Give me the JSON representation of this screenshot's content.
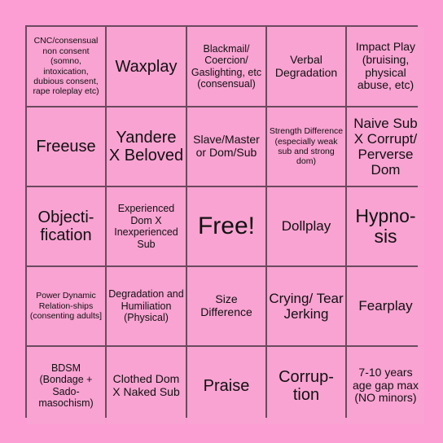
{
  "card": {
    "type": "bingo-card",
    "rows": 5,
    "columns": 5,
    "free_space_index": 12,
    "colors": {
      "page_background": "#fc9dd4",
      "cell_background": "#f9a3d2",
      "grid_line": "#6b4a5e",
      "text": "#111111"
    },
    "cells": [
      {
        "text": "CNC/consensual non consent (somno, intoxication, dubious consent, rape roleplay etc)",
        "size": "xs",
        "row": 1,
        "col": 1
      },
      {
        "text": "Waxplay",
        "size": "xl",
        "row": 1,
        "col": 2
      },
      {
        "text": "Blackmail/ Coercion/ Gaslighting, etc (consensual)",
        "size": "s",
        "row": 1,
        "col": 3
      },
      {
        "text": "Verbal Degradation",
        "size": "m",
        "row": 1,
        "col": 4
      },
      {
        "text": "Impact Play (bruising, physical abuse, etc)",
        "size": "m",
        "row": 1,
        "col": 5
      },
      {
        "text": "Freeuse",
        "size": "xl",
        "row": 2,
        "col": 1
      },
      {
        "text": "Yandere X Beloved",
        "size": "xl",
        "row": 2,
        "col": 2
      },
      {
        "text": "Slave/Master or Dom/Sub",
        "size": "m",
        "row": 2,
        "col": 3
      },
      {
        "text": "Strength Difference (especially weak sub and strong dom)",
        "size": "xs",
        "row": 2,
        "col": 4
      },
      {
        "text": "Naive Sub X Corrupt/ Perverse Dom",
        "size": "l",
        "row": 2,
        "col": 5
      },
      {
        "text": "Objecti-fication",
        "size": "xl",
        "row": 3,
        "col": 1
      },
      {
        "text": "Experienced Dom X Inexperienced Sub",
        "size": "s",
        "row": 3,
        "col": 2
      },
      {
        "text": "Free!",
        "size": "free",
        "row": 3,
        "col": 3
      },
      {
        "text": "Dollplay",
        "size": "l",
        "row": 3,
        "col": 4
      },
      {
        "text": "Hypno-sis",
        "size": "xxl",
        "row": 3,
        "col": 5
      },
      {
        "text": "Power Dynamic Relation-ships (consenting adults]",
        "size": "xs",
        "row": 4,
        "col": 1
      },
      {
        "text": "Degradation and Humiliation (Physical)",
        "size": "s",
        "row": 4,
        "col": 2
      },
      {
        "text": "Size Difference",
        "size": "m",
        "row": 4,
        "col": 3
      },
      {
        "text": "Crying/ Tear Jerking",
        "size": "l",
        "row": 4,
        "col": 4
      },
      {
        "text": "Fearplay",
        "size": "l",
        "row": 4,
        "col": 5
      },
      {
        "text": "BDSM (Bondage + Sado-masochism)",
        "size": "s",
        "row": 5,
        "col": 1
      },
      {
        "text": "Clothed Dom X Naked Sub",
        "size": "m",
        "row": 5,
        "col": 2
      },
      {
        "text": "Praise",
        "size": "xl",
        "row": 5,
        "col": 3
      },
      {
        "text": "Corrup-tion",
        "size": "xl",
        "row": 5,
        "col": 4
      },
      {
        "text": "7-10 years age gap max (NO minors)",
        "size": "m",
        "row": 5,
        "col": 5
      }
    ]
  }
}
